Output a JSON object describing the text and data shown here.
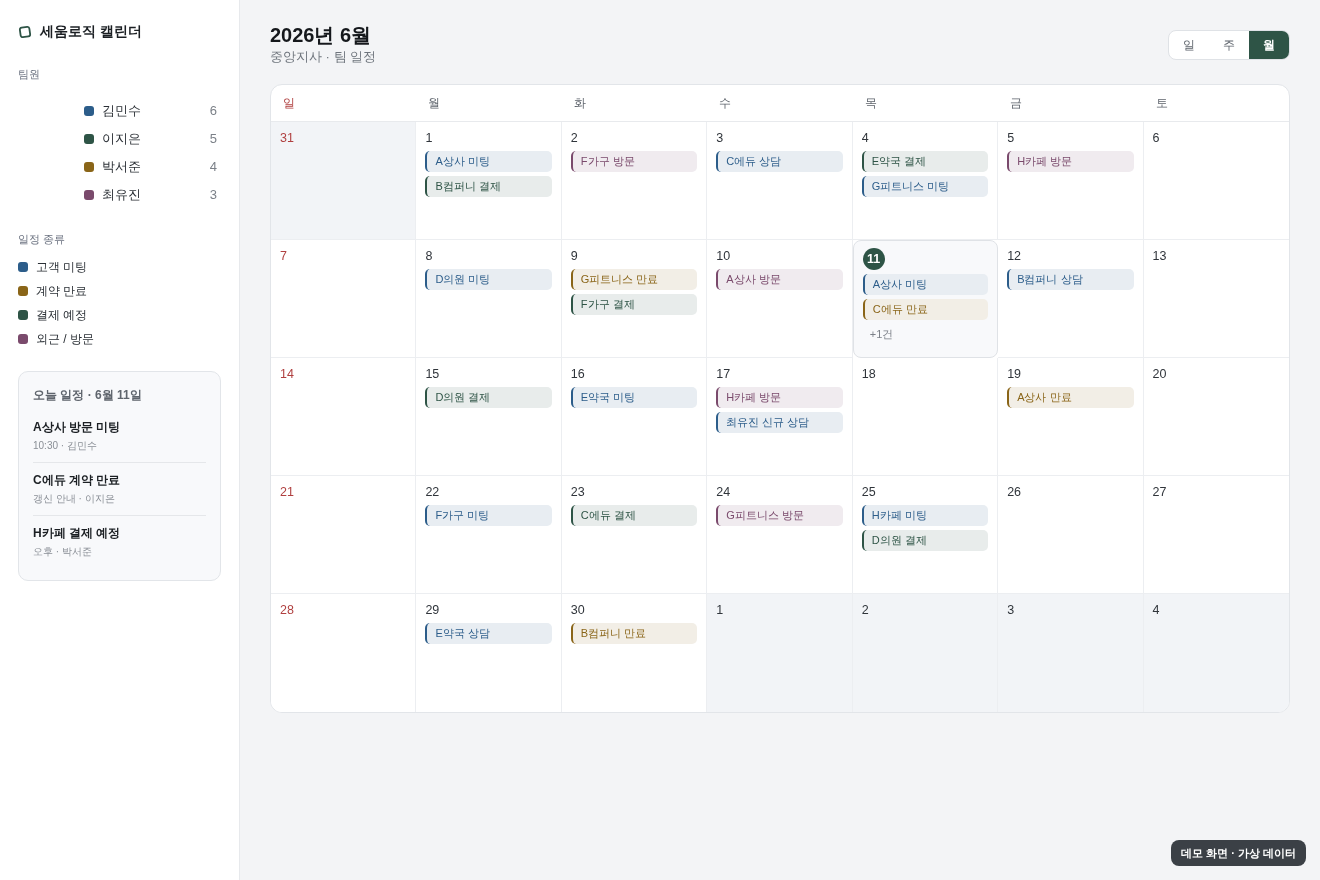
{
  "sidebar": {
    "brand": "세움로직 캘린더",
    "members_heading": "팀원",
    "members": [
      {
        "name": "김민수",
        "count": "6",
        "color": "#2c5d8a"
      },
      {
        "name": "이지은",
        "count": "5",
        "color": "#2e5446"
      },
      {
        "name": "박서준",
        "count": "4",
        "color": "#8a6518"
      },
      {
        "name": "최유진",
        "count": "3",
        "color": "#7a4a6c"
      }
    ],
    "types_heading": "일정 종류",
    "types": [
      {
        "label": "고객 미팅",
        "color": "#2c5d8a"
      },
      {
        "label": "계약 만료",
        "color": "#8a6518"
      },
      {
        "label": "결제 예정",
        "color": "#2e5446"
      },
      {
        "label": "외근 / 방문",
        "color": "#7a4a6c"
      }
    ],
    "today_panel": {
      "title": "오늘 일정 · 6월 11일",
      "items": [
        {
          "title": "A상사 방문 미팅",
          "detail": "10:30 · 김민수"
        },
        {
          "title": "C에듀 계약 만료",
          "detail": "갱신 안내 · 이지은"
        },
        {
          "title": "H카페 결제 예정",
          "detail": "오후 · 박서준"
        }
      ]
    }
  },
  "header": {
    "title": "2026년 6월",
    "subtitle": "중앙지사 · 팀 일정",
    "views": [
      {
        "label": "일",
        "selected": false
      },
      {
        "label": "주",
        "selected": false
      },
      {
        "label": "월",
        "selected": true
      }
    ]
  },
  "calendar": {
    "weekdays": [
      "일",
      "월",
      "화",
      "수",
      "목",
      "금",
      "토"
    ],
    "weeks": [
      [
        {
          "day": "31",
          "outside": true,
          "today": false
        },
        {
          "day": "1",
          "outside": false,
          "today": false,
          "events": [
            {
              "title": "A상사 미팅",
              "color": "#2c5d8a"
            },
            {
              "title": "B컴퍼니 결제",
              "color": "#2e5446"
            }
          ]
        },
        {
          "day": "2",
          "outside": false,
          "today": false,
          "events": [
            {
              "title": "F가구 방문",
              "color": "#7a4a6c"
            }
          ]
        },
        {
          "day": "3",
          "outside": false,
          "today": false,
          "events": [
            {
              "title": "C에듀 상담",
              "color": "#2c5d8a"
            }
          ]
        },
        {
          "day": "4",
          "outside": false,
          "today": false,
          "events": [
            {
              "title": "E약국 결제",
              "color": "#2e5446"
            },
            {
              "title": "G피트니스 미팅",
              "color": "#2c5d8a"
            }
          ]
        },
        {
          "day": "5",
          "outside": false,
          "today": false,
          "events": [
            {
              "title": "H카페 방문",
              "color": "#7a4a6c"
            }
          ]
        },
        {
          "day": "6",
          "outside": false,
          "today": false
        }
      ],
      [
        {
          "day": "7",
          "outside": false,
          "today": false
        },
        {
          "day": "8",
          "outside": false,
          "today": false,
          "events": [
            {
              "title": "D의원 미팅",
              "color": "#2c5d8a"
            }
          ]
        },
        {
          "day": "9",
          "outside": false,
          "today": false,
          "events": [
            {
              "title": "G피트니스 만료",
              "color": "#8a6518"
            },
            {
              "title": "F가구 결제",
              "color": "#2e5446"
            }
          ]
        },
        {
          "day": "10",
          "outside": false,
          "today": false,
          "events": [
            {
              "title": "A상사 방문",
              "color": "#7a4a6c"
            }
          ]
        },
        {
          "day": "11",
          "outside": false,
          "today": true,
          "events": [
            {
              "title": "A상사 미팅",
              "color": "#2c5d8a"
            },
            {
              "title": "C에듀 만료",
              "color": "#8a6518"
            }
          ],
          "more": "+1건"
        },
        {
          "day": "12",
          "outside": false,
          "today": false,
          "events": [
            {
              "title": "B컴퍼니 상담",
              "color": "#2c5d8a"
            }
          ]
        },
        {
          "day": "13",
          "outside": false,
          "today": false
        }
      ],
      [
        {
          "day": "14",
          "outside": false,
          "today": false
        },
        {
          "day": "15",
          "outside": false,
          "today": false,
          "events": [
            {
              "title": "D의원 결제",
              "color": "#2e5446"
            }
          ]
        },
        {
          "day": "16",
          "outside": false,
          "today": false,
          "events": [
            {
              "title": "E약국 미팅",
              "color": "#2c5d8a"
            }
          ]
        },
        {
          "day": "17",
          "outside": false,
          "today": false,
          "events": [
            {
              "title": "H카페 방문",
              "color": "#7a4a6c"
            },
            {
              "title": "최유진 신규 상담",
              "color": "#2c5d8a"
            }
          ]
        },
        {
          "day": "18",
          "outside": false,
          "today": false
        },
        {
          "day": "19",
          "outside": false,
          "today": false,
          "events": [
            {
              "title": "A상사 만료",
              "color": "#8a6518"
            }
          ]
        },
        {
          "day": "20",
          "outside": false,
          "today": false
        }
      ],
      [
        {
          "day": "21",
          "outside": false,
          "today": false
        },
        {
          "day": "22",
          "outside": false,
          "today": false,
          "events": [
            {
              "title": "F가구 미팅",
              "color": "#2c5d8a"
            }
          ]
        },
        {
          "day": "23",
          "outside": false,
          "today": false,
          "events": [
            {
              "title": "C에듀 결제",
              "color": "#2e5446"
            }
          ]
        },
        {
          "day": "24",
          "outside": false,
          "today": false,
          "events": [
            {
              "title": "G피트니스 방문",
              "color": "#7a4a6c"
            }
          ]
        },
        {
          "day": "25",
          "outside": false,
          "today": false,
          "events": [
            {
              "title": "H카페 미팅",
              "color": "#2c5d8a"
            },
            {
              "title": "D의원 결제",
              "color": "#2e5446"
            }
          ]
        },
        {
          "day": "26",
          "outside": false,
          "today": false
        },
        {
          "day": "27",
          "outside": false,
          "today": false
        }
      ],
      [
        {
          "day": "28",
          "outside": false,
          "today": false
        },
        {
          "day": "29",
          "outside": false,
          "today": false,
          "events": [
            {
              "title": "E약국 상담",
              "color": "#2c5d8a"
            }
          ]
        },
        {
          "day": "30",
          "outside": false,
          "today": false,
          "events": [
            {
              "title": "B컴퍼니 만료",
              "color": "#8a6518"
            }
          ]
        },
        {
          "day": "1",
          "outside": true,
          "today": false
        },
        {
          "day": "2",
          "outside": true,
          "today": false
        },
        {
          "day": "3",
          "outside": true,
          "today": false
        },
        {
          "day": "4",
          "outside": true,
          "today": false
        }
      ]
    ]
  },
  "demo_badge": "데모 화면 · 가상 데이터"
}
